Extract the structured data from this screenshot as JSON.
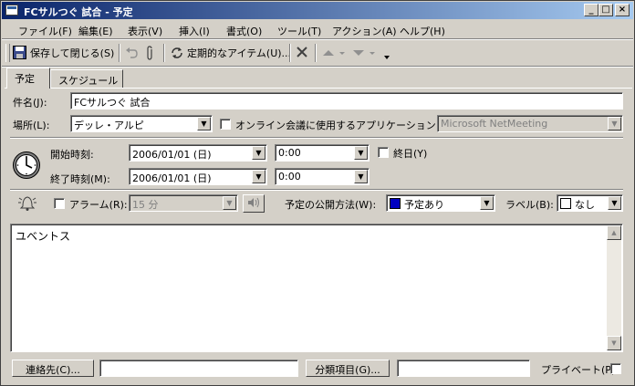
{
  "window": {
    "title": "FCサルつぐ 試合 - 予定",
    "controls": {
      "minimize": "_",
      "maximize": "□",
      "close": "×"
    }
  },
  "menu": [
    {
      "label": "ファイル(F)"
    },
    {
      "label": "編集(E)"
    },
    {
      "label": "表示(V)"
    },
    {
      "label": "挿入(I)"
    },
    {
      "label": "書式(O)"
    },
    {
      "label": "ツール(T)"
    },
    {
      "label": "アクション(A)"
    },
    {
      "label": "ヘルプ(H)"
    }
  ],
  "toolbar": {
    "save_close_label": "保存して閉じる(S)",
    "recurrence_label": "定期的なアイテム(U)..."
  },
  "tabs": [
    {
      "label": "予定",
      "active": true
    },
    {
      "label": "スケジュール",
      "active": false
    }
  ],
  "form": {
    "subject_label": "件名(J):",
    "subject_value": "FCサルつぐ 試合",
    "location_label": "場所(L):",
    "location_value": "デッレ・アルピ",
    "online_meeting_label": "オンライン会議に使用するアプリケーション:",
    "online_app_value": "Microsoft NetMeeting",
    "start_label": "開始時刻:",
    "start_date": "2006/01/01 (日)",
    "start_time": "0:00",
    "all_day_label": "終日(Y)",
    "end_label": "終了時刻(M):",
    "end_date": "2006/01/01 (日)",
    "end_time": "0:00",
    "alarm_label": "アラーム(R):",
    "alarm_value": "15 分",
    "show_time_as_label": "予定の公開方法(W):",
    "show_time_as_value": "予定あり",
    "label_label": "ラベル(B):",
    "label_value": "なし",
    "body_text": "ユベントス",
    "contacts_button": "連絡先(C)...",
    "categories_button": "分類項目(G)...",
    "private_label": "プライベート(P)"
  },
  "colors": {
    "busy_swatch": "#0000c0",
    "title_gradient_start": "#0a246a",
    "title_gradient_end": "#a6caf0"
  }
}
